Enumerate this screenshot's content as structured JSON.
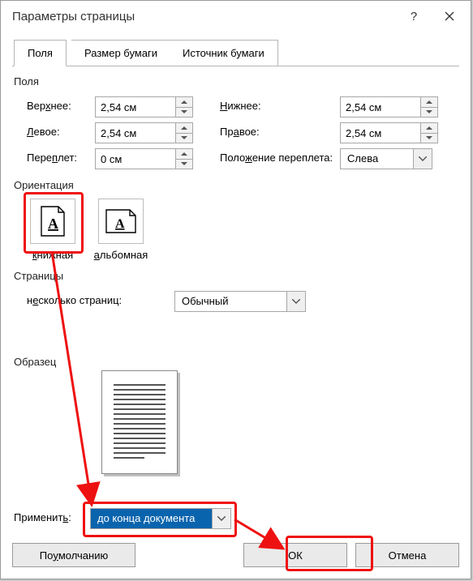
{
  "title": "Параметры страницы",
  "tabs": {
    "fields": "Поля",
    "paper": "Размер бумаги",
    "source": "Источник бумаги"
  },
  "group": {
    "fields": "Поля",
    "orientation": "Ориентация",
    "pages": "Страницы",
    "sample": "Образец"
  },
  "labels": {
    "top_pre": "Вер",
    "top_u": "х",
    "top_post": "нее:",
    "bottom_u": "Н",
    "bottom_post": "ижнее:",
    "left_u": "Л",
    "left_post": "евое:",
    "right_pre": "Пр",
    "right_u": "а",
    "right_post": "вое:",
    "gutter_pre": "Пере",
    "gutter_u": "п",
    "gutter_post": "лет:",
    "gutterpos_pre": "Поло",
    "gutterpos_u": "ж",
    "gutterpos_post": "ение переплета:",
    "portrait_u": "к",
    "portrait_post": "нижная",
    "landscape_u": "а",
    "landscape_post": "льбомная",
    "multipages_pre": "н",
    "multipages_u": "е",
    "multipages_post": "сколько страниц:",
    "applyto_pre": "Применит",
    "applyto_u": "ь",
    "applyto_post": ":"
  },
  "values": {
    "top": "2,54 см",
    "bottom": "2,54 см",
    "left": "2,54 см",
    "right": "2,54 см",
    "gutter": "0 см",
    "gutterpos": "Слева",
    "multipages": "Обычный",
    "applyto": "до конца документа"
  },
  "buttons": {
    "default_pre": "По ",
    "default_u": "у",
    "default_post": "молчанию",
    "ok": "ОК",
    "cancel": "Отмена"
  }
}
